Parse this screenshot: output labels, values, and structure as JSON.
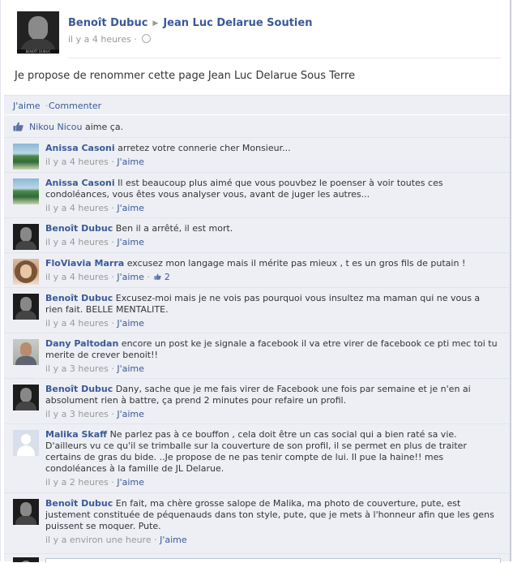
{
  "post": {
    "author": "Benoît Dubuc",
    "target_page": "Jean Luc Delarue Soutien",
    "time": "il y a 4 heures",
    "separator": "·",
    "text": "Je propose de renommer cette page Jean Luc Delarue Sous Terre",
    "avatar_caption": "BENOÎT DUBUC"
  },
  "actions": {
    "like": "J'aime",
    "separator": "·",
    "comment": "Commenter"
  },
  "likes": {
    "name": "Nikou Nicou",
    "suffix": "aime ça."
  },
  "comments": [
    {
      "author": "Anissa Casoni",
      "text": "arretez votre connerie cher Monsieur...",
      "time": "il y a 4 heures",
      "like": "J'aime",
      "sep": "·"
    },
    {
      "author": "Anissa Casoni",
      "text": "Il est beaucoup plus aimé que vous pouvbez le poenser à voir toutes ces condoléances, vous êtes vous analyser vous, avant de juger les autres...",
      "time": "il y a 4 heures",
      "like": "J'aime",
      "sep": "·"
    },
    {
      "author": "Benoît Dubuc",
      "text": "Ben il a arrêté, il est mort.",
      "time": "il y a 4 heures",
      "like": "J'aime",
      "sep": "·"
    },
    {
      "author": "FloViavia Marra",
      "text": "excusez mon langage mais il mérite pas mieux , t es un gros fils de putain !",
      "time": "il y a 4 heures",
      "like": "J'aime",
      "sep": "·",
      "like_count": "2"
    },
    {
      "author": "Benoît Dubuc",
      "text": "Excusez-moi mais je ne vois pas pourquoi vous insultez ma maman qui ne vous a rien fait. BELLE MENTALITE.",
      "time": "il y a 4 heures",
      "like": "J'aime",
      "sep": "·"
    },
    {
      "author": "Dany Paltodan",
      "text": "encore un post ke je signale a facebook il va etre virer de facebook ce pti mec toi tu merite de crever benoit!!",
      "time": "il y a 3 heures",
      "like": "J'aime",
      "sep": "·"
    },
    {
      "author": "Benoît Dubuc",
      "text": "Dany, sache que je me fais virer de Facebook une fois par semaine et je n'en ai absolument rien à battre, ça prend 2 minutes pour refaire un profil.",
      "time": "il y a 3 heures",
      "like": "J'aime",
      "sep": "·"
    },
    {
      "author": "Malika Skaff",
      "text": "Ne parlez pas à ce bouffon , cela doit être un cas social qui a bien raté sa vie. D'ailleurs vu ce qu'il se trimballe sur la couverture de son profil, il se permet en plus de traiter certains de gras du bide. ..Je propose de ne pas tenir compte de lui. Il pue la haine!! mes condoléances à la famille de JL Delarue.",
      "time": "il y a 2 heures",
      "like": "J'aime",
      "sep": "·"
    },
    {
      "author": "Benoît Dubuc",
      "text": "En fait, ma chère grosse salope de Malika, ma photo de couverture, pute, est justement constituée de péquenauds dans ton style, pute, que je mets à l'honneur afin que les gens puissent se moquer. Pute.",
      "time": "il y a environ une heure",
      "like": "J'aime",
      "sep": "·"
    }
  ],
  "colors": {
    "link": "#3b5998",
    "feed_bg": "#edeff4",
    "meta": "#999999"
  }
}
